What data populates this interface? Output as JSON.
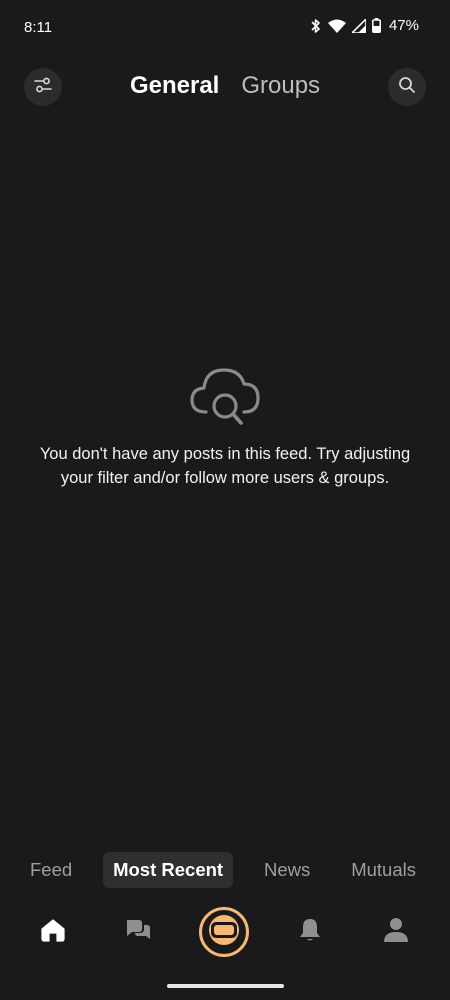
{
  "status_bar": {
    "time": "8:11",
    "battery": "47%",
    "icons": [
      "bluetooth-icon",
      "wifi-icon",
      "signal-icon",
      "battery-icon"
    ]
  },
  "header": {
    "tabs": [
      {
        "label": "General",
        "active": true
      },
      {
        "label": "Groups",
        "active": false
      }
    ],
    "left_icon": "filter-sliders-icon",
    "right_icon": "search-icon"
  },
  "empty_state": {
    "icon": "cloud-search-icon",
    "message": "You don't have any posts in this feed. Try adjusting your filter and/or follow more users & groups."
  },
  "feed_tabs": [
    {
      "label": "Feed",
      "active": false
    },
    {
      "label": "Most Recent",
      "active": true
    },
    {
      "label": "News",
      "active": false
    },
    {
      "label": "Mutuals",
      "active": false
    }
  ],
  "bottom_nav": {
    "items": [
      "home-icon",
      "chat-bubbles-icon",
      "app-center-icon",
      "bell-icon",
      "profile-icon"
    ],
    "accent": "#f5b971"
  },
  "colors": {
    "background": "#1a1a1a",
    "accent": "#f5b971",
    "inactive_text": "#9e9e9e"
  }
}
